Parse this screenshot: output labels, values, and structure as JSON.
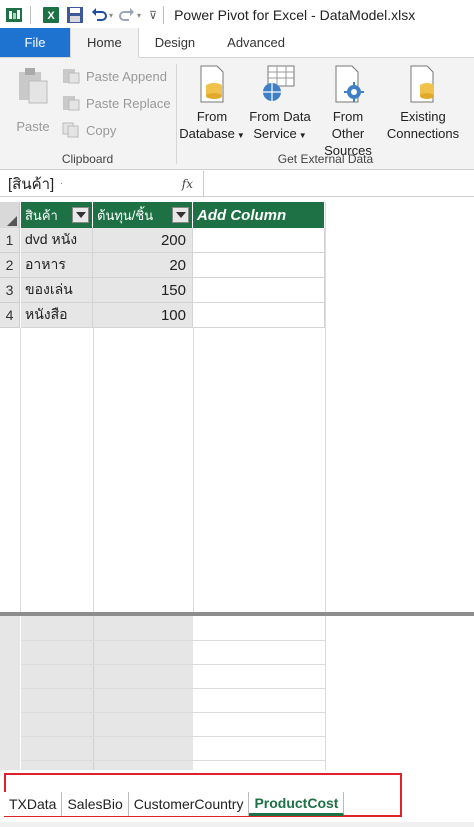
{
  "window": {
    "title": "Power Pivot for Excel - DataModel.xlsx"
  },
  "ribbon": {
    "tabs": [
      {
        "label": "File"
      },
      {
        "label": "Home"
      },
      {
        "label": "Design"
      },
      {
        "label": "Advanced"
      }
    ],
    "active_tab": "Home",
    "clipboard": {
      "label": "Clipboard",
      "paste": "Paste",
      "paste_append": "Paste Append",
      "paste_replace": "Paste Replace",
      "copy": "Copy"
    },
    "external": {
      "label": "Get External Data",
      "from_database": [
        "From",
        "Database"
      ],
      "from_data_service": [
        "From Data",
        "Service"
      ],
      "from_other_sources": [
        "From Other",
        "Sources"
      ],
      "existing_connections": [
        "Existing",
        "Connections"
      ]
    }
  },
  "formula_bar": {
    "name_box": "[สินค้า]",
    "fx": "fx",
    "value": ""
  },
  "table": {
    "columns": [
      "สินค้า",
      "ต้นทุน/ชิ้น",
      "Add Column"
    ],
    "rows": [
      {
        "num": "1",
        "product": "dvd หนัง",
        "cost": "200"
      },
      {
        "num": "2",
        "product": "อาหาร",
        "cost": "20"
      },
      {
        "num": "3",
        "product": "ของเล่น",
        "cost": "150"
      },
      {
        "num": "4",
        "product": "หนังสือ",
        "cost": "100"
      }
    ]
  },
  "sheets": {
    "tabs": [
      "TXData",
      "SalesBio",
      "CustomerCountry",
      "ProductCost"
    ],
    "active": "ProductCost"
  },
  "colors": {
    "file_tab": "#1e73d0",
    "table_header": "#1e7145",
    "highlight_box": "#e0202a"
  }
}
